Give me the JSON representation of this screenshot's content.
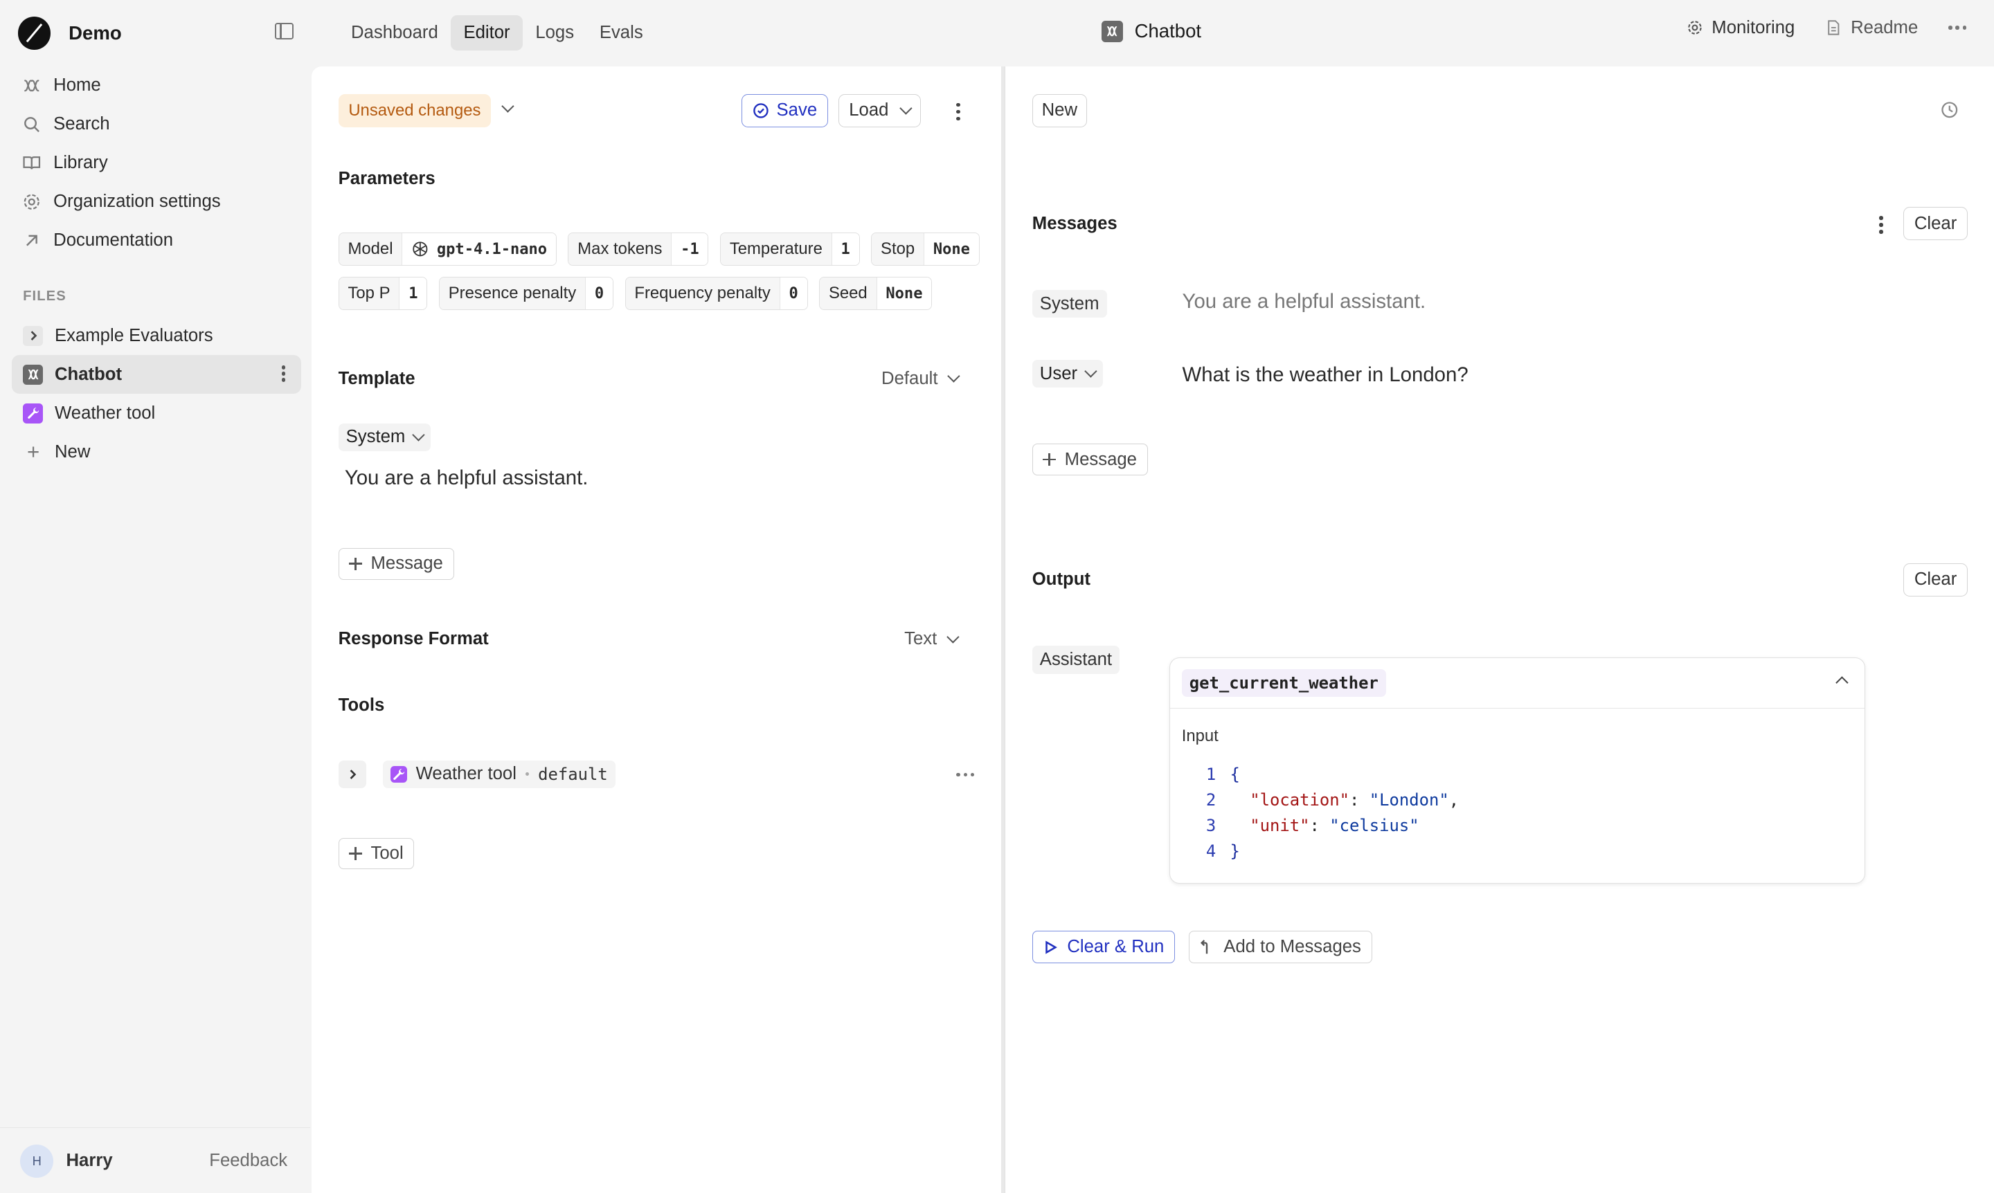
{
  "workspace": {
    "name": "Demo"
  },
  "sidebar": {
    "nav": [
      {
        "label": "Home",
        "icon": "home-icon"
      },
      {
        "label": "Search",
        "icon": "search-icon"
      },
      {
        "label": "Library",
        "icon": "book-icon"
      },
      {
        "label": "Organization settings",
        "icon": "gear-icon"
      },
      {
        "label": "Documentation",
        "icon": "arrow-up-right-icon"
      }
    ],
    "files_label": "FILES",
    "files": [
      {
        "label": "Example Evaluators",
        "icon": "chevron-right-icon"
      },
      {
        "label": "Chatbot",
        "icon": "prompt-icon",
        "active": true
      },
      {
        "label": "Weather tool",
        "icon": "tool-icon"
      },
      {
        "label": "New",
        "icon": "plus-icon"
      }
    ],
    "user": {
      "initial": "H",
      "name": "Harry"
    },
    "feedback_label": "Feedback"
  },
  "topbar": {
    "tabs": [
      "Dashboard",
      "Editor",
      "Logs",
      "Evals"
    ],
    "active_tab": "Editor",
    "title": "Chatbot",
    "monitoring_label": "Monitoring",
    "readme_label": "Readme"
  },
  "editor": {
    "status_badge": "Unsaved changes",
    "save_label": "Save",
    "load_label": "Load",
    "parameters_title": "Parameters",
    "params_row1": [
      {
        "key": "Model",
        "value": "gpt-4.1-nano"
      },
      {
        "key": "Max tokens",
        "value": "-1"
      },
      {
        "key": "Temperature",
        "value": "1"
      },
      {
        "key": "Stop",
        "value": "None"
      }
    ],
    "params_row2": [
      {
        "key": "Top P",
        "value": "1"
      },
      {
        "key": "Presence penalty",
        "value": "0"
      },
      {
        "key": "Frequency penalty",
        "value": "0"
      },
      {
        "key": "Seed",
        "value": "None"
      }
    ],
    "template_title": "Template",
    "template_mode": "Default",
    "template_role": "System",
    "template_text": "You are a helpful assistant.",
    "add_message_label": "Message",
    "response_format_title": "Response Format",
    "response_format_value": "Text",
    "tools_title": "Tools",
    "tool": {
      "name": "Weather tool",
      "version": "default"
    },
    "add_tool_label": "Tool"
  },
  "run": {
    "new_label": "New",
    "messages_title": "Messages",
    "clear_label": "Clear",
    "system_role": "System",
    "system_text": "You are a helpful assistant.",
    "user_role": "User",
    "user_text": "What is the weather in London?",
    "add_message_label": "Message",
    "output_title": "Output",
    "output_clear_label": "Clear",
    "assistant_role": "Assistant",
    "tool_call": {
      "name": "get_current_weather",
      "input_label": "Input",
      "lines": [
        {
          "n": "1",
          "open": "{"
        },
        {
          "n": "2",
          "key": "\"location\"",
          "colon": ": ",
          "val": "\"London\"",
          "tail": ","
        },
        {
          "n": "3",
          "key": "\"unit\"",
          "colon": ": ",
          "val": "\"celsius\"",
          "tail": ""
        },
        {
          "n": "4",
          "open": "}"
        }
      ]
    },
    "clear_run_label": "Clear & Run",
    "add_to_messages_label": "Add to Messages"
  }
}
